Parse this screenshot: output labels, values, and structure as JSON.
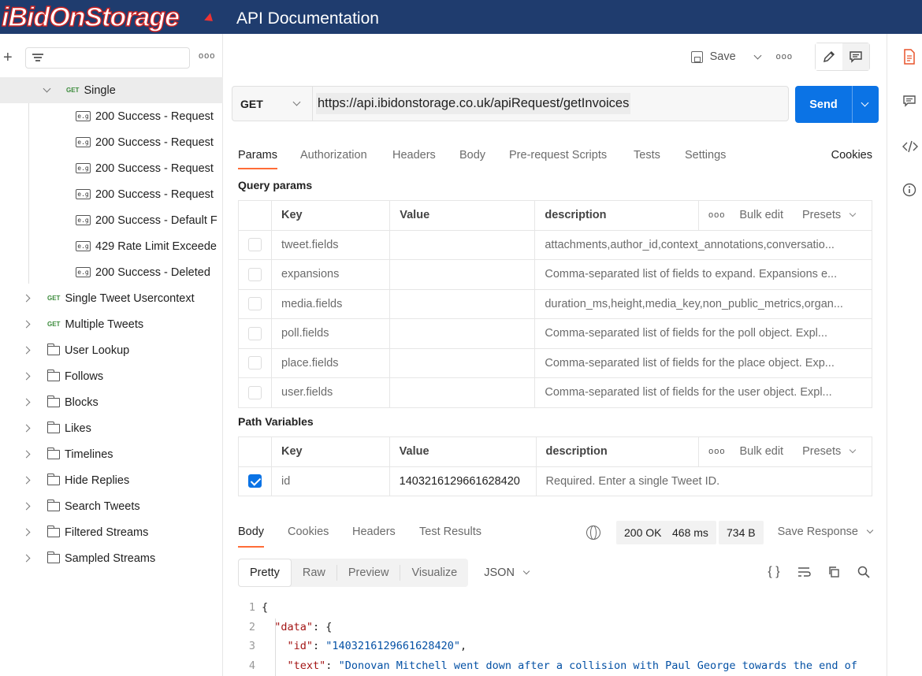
{
  "header": {
    "logo_text": "iBidOnStorage",
    "title": "API Documentation",
    "bg_color": "#1f3c6e"
  },
  "sidebar": {
    "tree": [
      {
        "kind": "request",
        "label": "Single",
        "expanded": true,
        "selected": true,
        "method": "GET"
      },
      {
        "kind": "example",
        "label": "200 Success - Request"
      },
      {
        "kind": "example",
        "label": "200 Success - Request"
      },
      {
        "kind": "example",
        "label": "200 Success - Request"
      },
      {
        "kind": "example",
        "label": "200 Success - Request"
      },
      {
        "kind": "example",
        "label": "200 Success - Default F"
      },
      {
        "kind": "example",
        "label": "429 Rate Limit Exceede"
      },
      {
        "kind": "example",
        "label": "200 Success - Deleted"
      },
      {
        "kind": "request",
        "label": "Single Tweet Usercontext",
        "method": "GET"
      },
      {
        "kind": "request",
        "label": "Multiple Tweets",
        "method": "GET"
      },
      {
        "kind": "folder",
        "label": "User Lookup"
      },
      {
        "kind": "folder",
        "label": "Follows"
      },
      {
        "kind": "folder",
        "label": "Blocks"
      },
      {
        "kind": "folder",
        "label": "Likes"
      },
      {
        "kind": "folder",
        "label": "Timelines"
      },
      {
        "kind": "folder",
        "label": "Hide Replies"
      },
      {
        "kind": "folder",
        "label": "Search Tweets"
      },
      {
        "kind": "folder",
        "label": "Filtered Streams"
      },
      {
        "kind": "folder",
        "label": "Sampled Streams"
      }
    ],
    "method_badge": "GET",
    "example_badge": "e.g"
  },
  "toolbar": {
    "save_label": "Save",
    "more_label": "ooo"
  },
  "request": {
    "method": "GET",
    "url": "https://api.ibidonstorage.co.uk/apiRequest/getInvoices",
    "send_label": "Send",
    "tabs": [
      "Params",
      "Authorization",
      "Headers",
      "Body",
      "Pre-request Scripts",
      "Tests",
      "Settings"
    ],
    "active_tab": "Params",
    "cookies_label": "Cookies"
  },
  "query_params": {
    "title": "Query params",
    "headers": {
      "key": "Key",
      "value": "Value",
      "description": "description",
      "more": "ooo",
      "bulk_edit": "Bulk edit",
      "presets": "Presets"
    },
    "rows": [
      {
        "checked": false,
        "key": "tweet.fields",
        "value": "",
        "description": "attachments,author_id,context_annotations,conversatio..."
      },
      {
        "checked": false,
        "key": "expansions",
        "value": "",
        "description": "Comma-separated list of fields to expand. Expansions e..."
      },
      {
        "checked": false,
        "key": "media.fields",
        "value": "",
        "description": "duration_ms,height,media_key,non_public_metrics,organ..."
      },
      {
        "checked": false,
        "key": "poll.fields",
        "value": "",
        "description": "Comma-separated list of fields for the poll object. Expl..."
      },
      {
        "checked": false,
        "key": "place.fields",
        "value": "",
        "description": "Comma-separated list of fields for the place object. Exp..."
      },
      {
        "checked": false,
        "key": "user.fields",
        "value": "",
        "description": "Comma-separated list of fields for the user object. Expl..."
      }
    ]
  },
  "path_variables": {
    "title": "Path Variables",
    "headers": {
      "key": "Key",
      "value": "Value",
      "description": "description",
      "more": "ooo",
      "bulk_edit": "Bulk edit",
      "presets": "Presets"
    },
    "rows": [
      {
        "checked": true,
        "key": "id",
        "value": "1403216129661628420",
        "description": "Required. Enter a single Tweet ID."
      }
    ]
  },
  "response": {
    "tabs": [
      "Body",
      "Cookies",
      "Headers",
      "Test Results"
    ],
    "active_tab": "Body",
    "status": "200 OK",
    "time": "468 ms",
    "size": "734 B",
    "save_response": "Save Response",
    "views": [
      "Pretty",
      "Raw",
      "Preview",
      "Visualize"
    ],
    "active_view": "Pretty",
    "format": "JSON",
    "code_lines": [
      {
        "n": "1",
        "parts": [
          {
            "t": "{",
            "c": "p"
          }
        ]
      },
      {
        "n": "2",
        "parts": [
          {
            "t": "  ",
            "c": "p"
          },
          {
            "t": "\"data\"",
            "c": "k"
          },
          {
            "t": ": {",
            "c": "p"
          }
        ]
      },
      {
        "n": "3",
        "parts": [
          {
            "t": "    ",
            "c": "p"
          },
          {
            "t": "\"id\"",
            "c": "k"
          },
          {
            "t": ": ",
            "c": "p"
          },
          {
            "t": "\"1403216129661628420\"",
            "c": "s"
          },
          {
            "t": ",",
            "c": "p"
          }
        ]
      },
      {
        "n": "4",
        "parts": [
          {
            "t": "    ",
            "c": "p"
          },
          {
            "t": "\"text\"",
            "c": "k"
          },
          {
            "t": ": ",
            "c": "p"
          },
          {
            "t": "\"Donovan Mitchell went down after a collision with Paul George towards the end of",
            "c": "s"
          }
        ]
      }
    ]
  },
  "colors": {
    "accent": "#ff6c37",
    "primary": "#0b73e5",
    "get_method": "#3a8a3a"
  }
}
